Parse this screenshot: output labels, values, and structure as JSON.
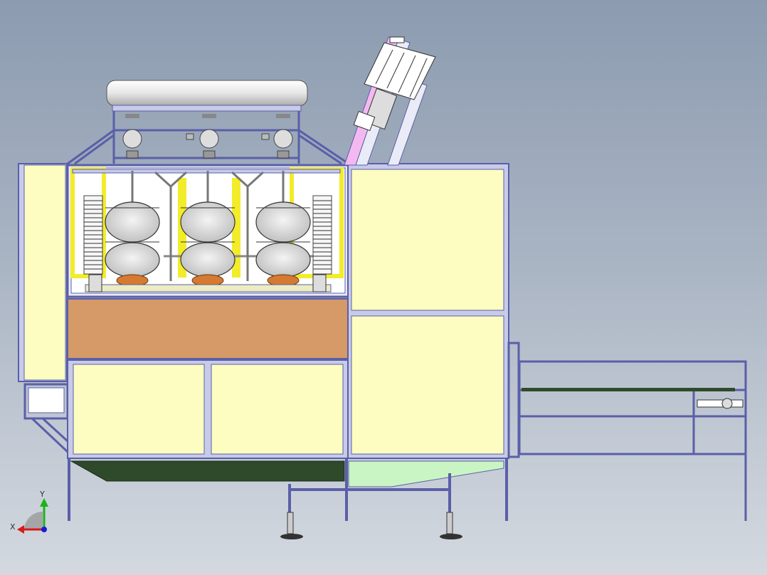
{
  "viewport": {
    "background_top": "#8c9bb0",
    "background_bottom": "#d4d9e0"
  },
  "colors": {
    "frame": "#5a5fa8",
    "frame_fill": "#c8cbe8",
    "panel": "#fdfdc2",
    "guard_yellow": "#f2ec2a",
    "table_top": "#d59a68",
    "conveyor_dark": "#2f4a2a",
    "chute_green": "#c9f5c4",
    "pink_chute": "#f4b8f0",
    "bowl_orange": "#d57a30"
  },
  "triad": {
    "x_label": "X",
    "y_label": "Y",
    "x_color": "#d81a1a",
    "y_color": "#18b418",
    "z_color": "#1a1ad8"
  },
  "machine": {
    "bottle_stations": 3,
    "feet": 2
  }
}
